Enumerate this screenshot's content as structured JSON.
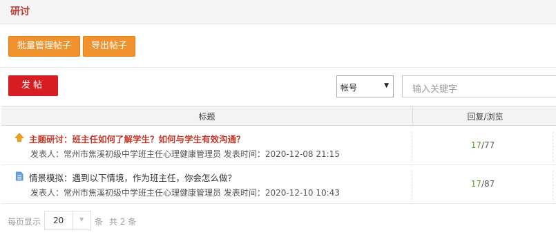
{
  "header": {
    "title": "研讨"
  },
  "toolbar": {
    "batch_manage_label": "批量管理帖子",
    "export_label": "导出帖子"
  },
  "actions": {
    "post_label": "发帖"
  },
  "search": {
    "field_selected": "帐号",
    "placeholder": "输入关键字"
  },
  "table": {
    "columns": {
      "title": "标题",
      "reply_views": "回复/浏览"
    },
    "rows": [
      {
        "title": "主题研讨：班主任如何了解学生？如何与学生有效沟通？",
        "icon": "arrow-up-icon",
        "meta": "发表人：常州市焦溪初级中学班主任心理健康管理员  发表时间：2020-12-08 21:15",
        "replies": "17",
        "views": "/77"
      },
      {
        "title": "情景模拟：遇到以下情境，作为班主任，你会怎么做？",
        "icon": "document-icon",
        "meta": "发表人：常州市焦溪初级中学班主任心理健康管理员  发表时间：2020-12-10 10:43",
        "replies": "17",
        "views": "/87"
      }
    ]
  },
  "pager": {
    "per_page_label": "每页显示",
    "page_size": "20",
    "unit": "条",
    "total": "共 2 条"
  },
  "colors": {
    "accent_red": "#c0392b",
    "button_orange": "#f0932f",
    "post_red": "#d61e22",
    "reply_green": "#5a9e2f"
  }
}
